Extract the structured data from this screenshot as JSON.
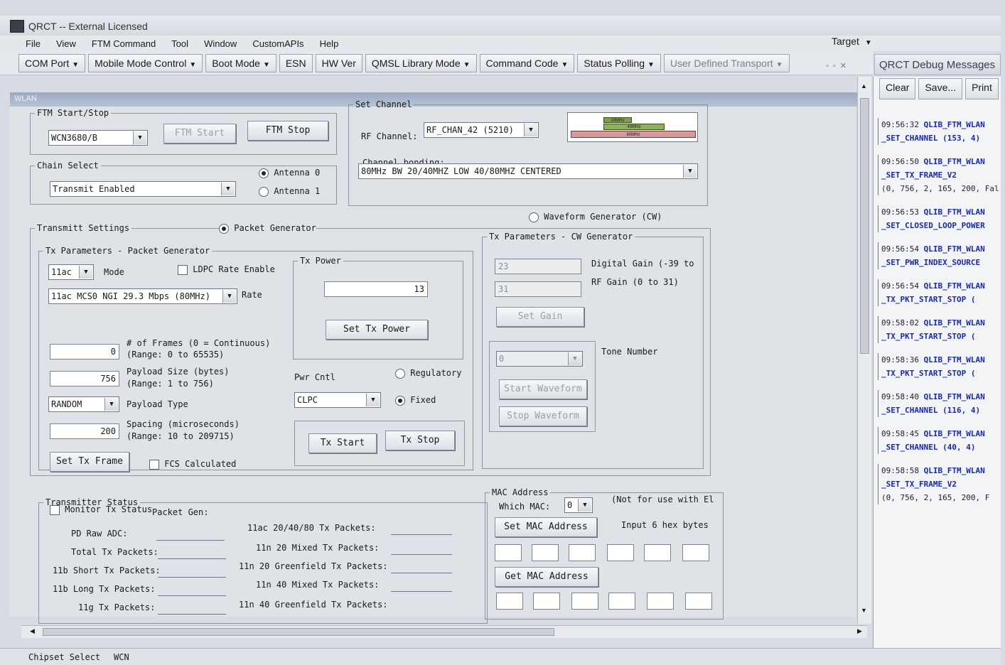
{
  "window": {
    "title": "QRCT -- External Licensed"
  },
  "menu": [
    "File",
    "View",
    "FTM Command",
    "Tool",
    "Window",
    "CustomAPIs",
    "Help"
  ],
  "toolbar": {
    "com_port": "COM Port",
    "mobile_mode": "Mobile Mode Control",
    "boot_mode": "Boot Mode",
    "esn": "ESN",
    "hw_ver": "HW Ver",
    "qmsl": "QMSL Library Mode",
    "command_code": "Command Code",
    "status_polling": "Status Polling",
    "user_transport": "User Defined Transport",
    "target": "Target"
  },
  "wlan_tab": "WLAN",
  "ftm": {
    "legend": "FTM Start/Stop",
    "chip": "WCN3680/B",
    "start": "FTM Start",
    "stop": "FTM Stop"
  },
  "chain": {
    "legend": "Chain Select",
    "value": "Transmit Enabled",
    "antenna0": "Antenna 0",
    "antenna1": "Antenna 1"
  },
  "channel": {
    "legend": "Set Channel",
    "rf_label": "RF Channel:",
    "rf_value": "RF_CHAN_42 (5210)",
    "bond_label": "Channel bonding:",
    "bond_value": "80MHz BW 20/40MHZ LOW 40/80MHZ CENTERED",
    "diagram": [
      "20MHz",
      "40MHz",
      "80MHz"
    ]
  },
  "tx": {
    "legend": "Transmitt Settings",
    "packet_gen": "Packet Generator",
    "waveform_gen": "Waveform Generator (CW)",
    "pkt_legend": "Tx Parameters - Packet Generator",
    "mode": "11ac",
    "mode_label": "Mode",
    "ldpc": "LDPC Rate Enable",
    "rate": "11ac MCS0 NGI 29.3 Mbps (80MHz)",
    "rate_label": "Rate",
    "frames": "0",
    "frames_label": "# of Frames (0 = Continuous)",
    "frames_range": "(Range: 0 to 65535)",
    "payload": "756",
    "payload_label": "Payload Size (bytes)",
    "payload_range": "(Range: 1 to 756)",
    "payload_type": "RANDOM",
    "payload_type_label": "Payload Type",
    "spacing": "200",
    "spacing_label": "Spacing (microseconds)",
    "spacing_range": "(Range: 10 to 209715)",
    "set_frame": "Set Tx Frame",
    "fcs": "FCS Calculated",
    "power_legend": "Tx Power",
    "power": "13",
    "set_power": "Set Tx Power",
    "pwr_cntl": "Pwr Cntl",
    "pwr_value": "CLPC",
    "regulatory": "Regulatory",
    "fixed": "Fixed",
    "start": "Tx Start",
    "stop": "Tx Stop",
    "cw_legend": "Tx Parameters - CW Generator",
    "dgain": "23",
    "dgain_label": "Digital Gain (-39 to",
    "rfgain": "31",
    "rfgain_label": "RF Gain (0 to 31)",
    "set_gain": "Set Gain",
    "tone": "0",
    "tone_label": "Tone Number",
    "start_wave": "Start Waveform",
    "stop_wave": "Stop Waveform"
  },
  "status": {
    "legend": "Transmitter Status",
    "monitor": "Monitor Tx Status",
    "packet_gen": "Packet Gen:",
    "left": [
      "PD Raw ADC:",
      "Total Tx Packets:",
      "11b Short Tx Packets:",
      "11b Long Tx Packets:",
      "11g Tx Packets:"
    ],
    "right": [
      "11ac 20/40/80 Tx Packets:",
      "11n 20 Mixed Tx Packets:",
      "11n 20 Greenfield Tx Packets:",
      "11n 40 Mixed Tx Packets:",
      "11n 40 Greenfield Tx Packets:"
    ]
  },
  "mac": {
    "legend": "MAC Address",
    "which": "Which MAC:",
    "which_value": "0",
    "note": "(Not for use with El",
    "set": "Set MAC Address",
    "input_hint": "Input 6  hex bytes",
    "get": "Get MAC Address"
  },
  "debug": {
    "title": "QRCT Debug Messages",
    "clear": "Clear",
    "save": "Save...",
    "print": "Print",
    "entries": [
      {
        "time": "09:56:32",
        "cmd": "QLIB_FTM_WLAN",
        "arg": "_SET_CHANNEL (153, 4)"
      },
      {
        "time": "09:56:50",
        "cmd": "QLIB_FTM_WLAN",
        "arg": "_SET_TX_FRAME_V2",
        "extra": "(0, 756, 2, 165, 200, Fal"
      },
      {
        "time": "09:56:53",
        "cmd": "QLIB_FTM_WLAN",
        "arg": "_SET_CLOSED_LOOP_POWER"
      },
      {
        "time": "09:56:54",
        "cmd": "QLIB_FTM_WLAN",
        "arg": "_SET_PWR_INDEX_SOURCE"
      },
      {
        "time": "09:56:54",
        "cmd": "QLIB_FTM_WLAN",
        "arg": "_TX_PKT_START_STOP ("
      },
      {
        "time": "09:58:02",
        "cmd": "QLIB_FTM_WLAN",
        "arg": "_TX_PKT_START_STOP ("
      },
      {
        "time": "09:58:36",
        "cmd": "QLIB_FTM_WLAN",
        "arg": "_TX_PKT_START_STOP ("
      },
      {
        "time": "09:58:40",
        "cmd": "QLIB_FTM_WLAN",
        "arg": "_SET_CHANNEL (116, 4)"
      },
      {
        "time": "09:58:45",
        "cmd": "QLIB_FTM_WLAN",
        "arg": "_SET_CHANNEL (40, 4)"
      },
      {
        "time": "09:58:58",
        "cmd": "QLIB_FTM_WLAN",
        "arg": "_SET_TX_FRAME_V2",
        "extra": "(0, 756, 2, 165, 200, F"
      }
    ]
  },
  "statusbar": {
    "chipset_label": "Chipset Select",
    "chipset_value": "WCN"
  }
}
